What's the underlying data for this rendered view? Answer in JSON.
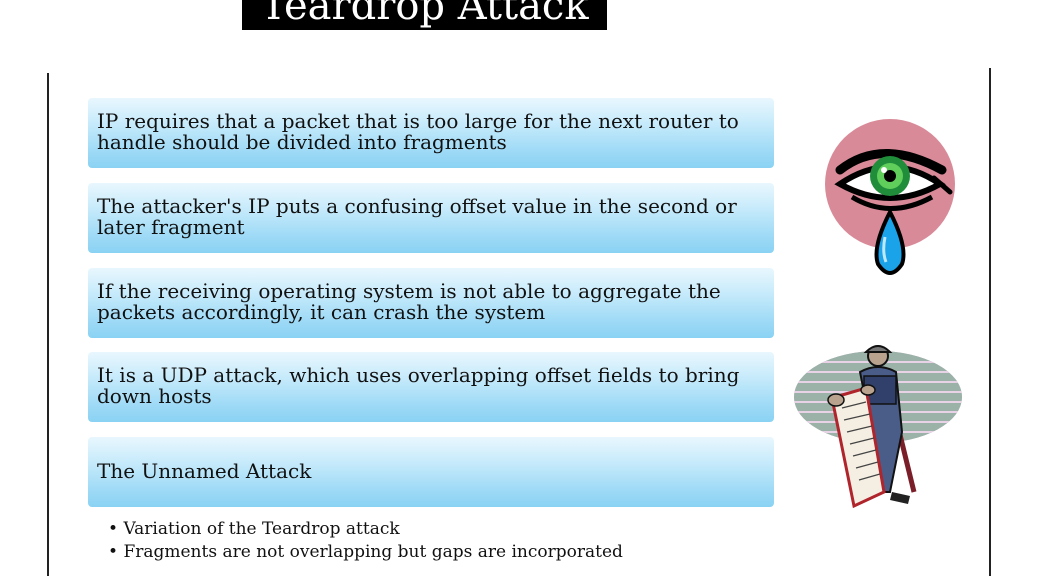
{
  "slide": {
    "title": "Teardrop Attack",
    "bars": [
      "IP requires that a packet that is too large for the next router to handle should be divided into fragments",
      "The attacker's IP puts a confusing offset value in the second or later fragment",
      "If the receiving operating system is not able to aggregate the packets accordingly, it can crash the system",
      "It is a UDP attack, which uses overlapping offset fields to bring down hosts",
      "The Unnamed Attack"
    ],
    "sub_bullets": [
      "Variation of the Teardrop attack",
      "Fragments are not overlapping  but gaps are incorporated"
    ]
  },
  "art": {
    "eye_icon": "crying-eye-clipart",
    "soldier_icon": "soldier-reading-scroll-clipart"
  }
}
